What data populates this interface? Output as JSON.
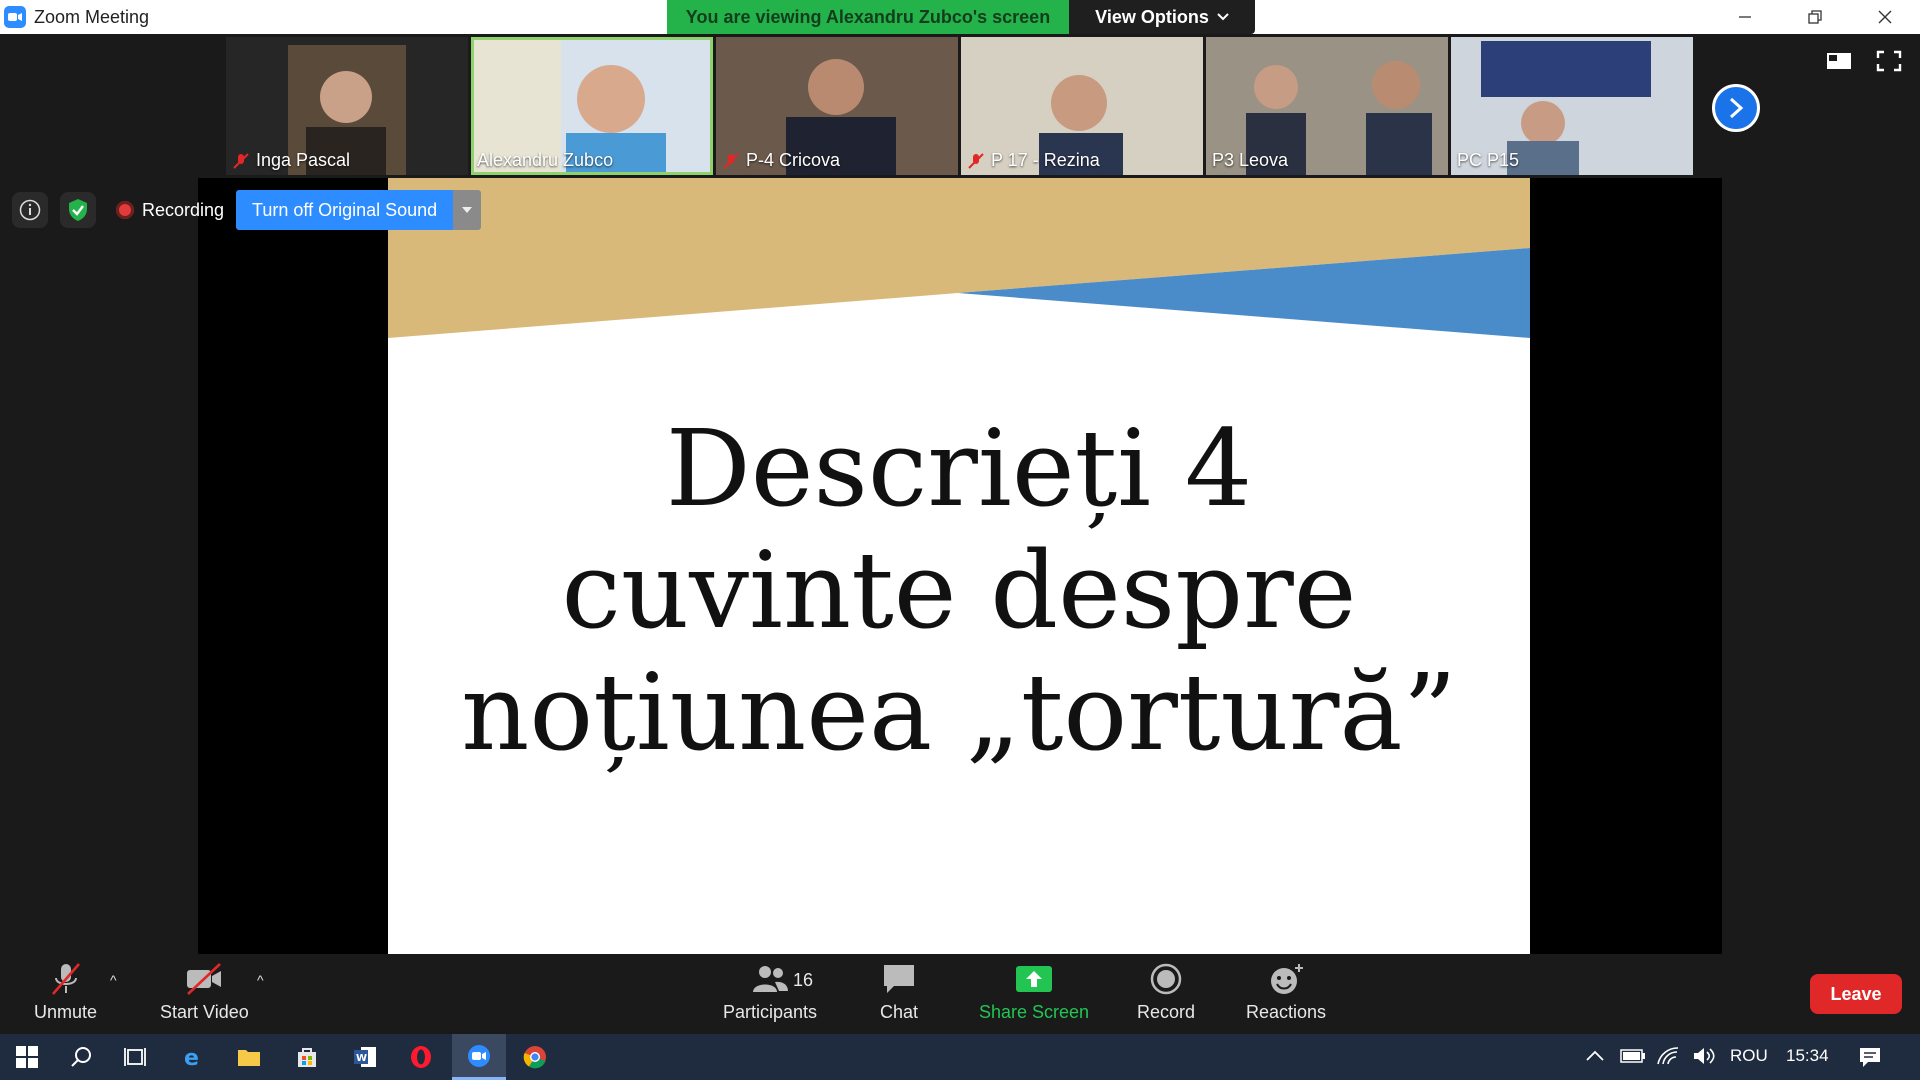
{
  "window": {
    "title": "Zoom Meeting",
    "viewing_banner": "You are viewing Alexandru Zubco's screen",
    "view_options_label": "View Options"
  },
  "participants_strip": [
    {
      "name": "Inga Pascal",
      "muted": true,
      "active": false
    },
    {
      "name": "Alexandru Zubco",
      "muted": false,
      "active": true
    },
    {
      "name": "P-4 Cricova",
      "muted": true,
      "active": false
    },
    {
      "name": "P 17 - Rezina",
      "muted": true,
      "active": false
    },
    {
      "name": "P3 Leova",
      "muted": false,
      "active": false
    },
    {
      "name": "PC P15",
      "muted": false,
      "active": false
    }
  ],
  "status": {
    "recording_label": "Recording",
    "original_sound_button": "Turn off Original Sound"
  },
  "slide": {
    "lines": [
      "Descrieți 4",
      "cuvinte despre",
      "noțiunea „tortură”"
    ]
  },
  "toolbar": {
    "unmute_label": "Unmute",
    "start_video_label": "Start Video",
    "participants_label": "Participants",
    "participants_count": "16",
    "chat_label": "Chat",
    "share_screen_label": "Share Screen",
    "record_label": "Record",
    "reactions_label": "Reactions",
    "leave_label": "Leave"
  },
  "taskbar": {
    "language": "ROU",
    "time": "15:34"
  },
  "colors": {
    "zoom_blue": "#2d8cff",
    "banner_green": "#23b34a",
    "leave_red": "#e02828",
    "slide_gold": "#d9b97a",
    "slide_blue": "#4a8cc9"
  }
}
